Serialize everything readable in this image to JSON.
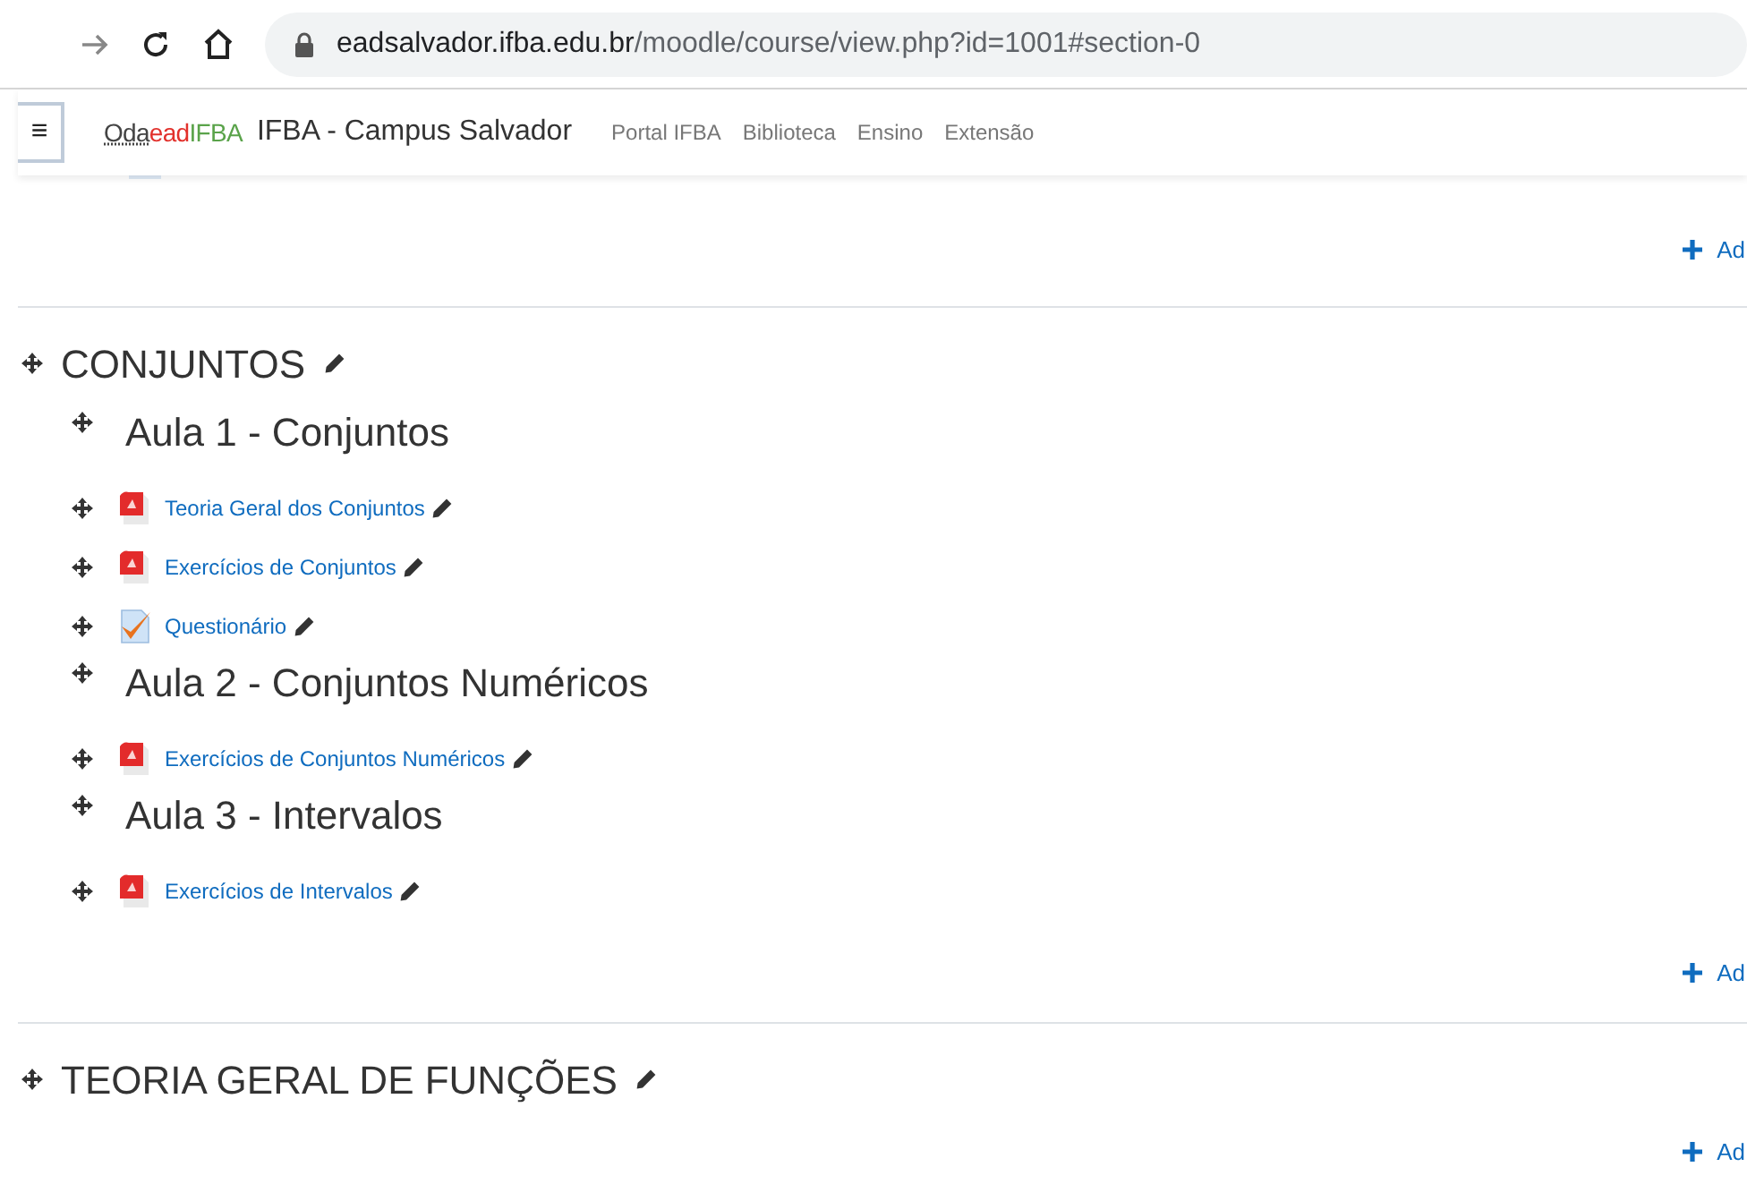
{
  "browser": {
    "url_host": "eadsalvador.ifba.edu.br",
    "url_path": "/moodle/course/view.php?id=1001#section-0"
  },
  "navbar": {
    "menu_glyph": "≡",
    "logo": {
      "part_1": "Oda",
      "part_2": "ead",
      "part_3": "IFBA"
    },
    "site_name": "IFBA - Campus Salvador",
    "links": [
      "Portal IFBA",
      "Biblioteca",
      "Ensino",
      "Extensão"
    ]
  },
  "top_add": "Ad",
  "sections": [
    {
      "title": "CONJUNTOS",
      "items": [
        {
          "kind": "heading",
          "label": "Aula 1 - Conjuntos"
        },
        {
          "kind": "pdf",
          "label": "Teoria Geral dos Conjuntos"
        },
        {
          "kind": "pdf",
          "label": "Exercícios de Conjuntos"
        },
        {
          "kind": "quiz",
          "label": "Questionário"
        },
        {
          "kind": "heading",
          "label": "Aula 2 - Conjuntos Numéricos"
        },
        {
          "kind": "pdf",
          "label": "Exercícios de Conjuntos Numéricos"
        },
        {
          "kind": "heading",
          "label": "Aula 3 - Intervalos"
        },
        {
          "kind": "pdf",
          "label": "Exercícios de Intervalos"
        }
      ],
      "add": "Ad"
    },
    {
      "title": "TEORIA GERAL DE FUNÇÕES",
      "add": "Ad"
    }
  ]
}
